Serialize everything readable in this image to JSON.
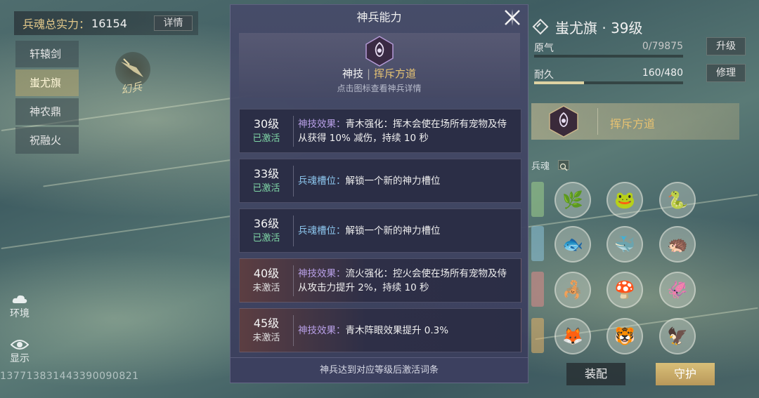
{
  "power": {
    "label": "兵魂总实力：",
    "value": "16154",
    "detail_label": "详情"
  },
  "weapons": [
    {
      "label": "轩辕剑",
      "active": false
    },
    {
      "label": "蚩尤旗",
      "active": true
    },
    {
      "label": "神农鼎",
      "active": false
    },
    {
      "label": "祝融火",
      "active": false
    }
  ],
  "emblem_text": "幻兵",
  "sidebar": {
    "env_label": "环境",
    "display_label": "显示"
  },
  "uid": "13771383144339009082​1",
  "panel": {
    "title": "神兵能力",
    "skill_kind": "神技",
    "skill_sep": "|",
    "skill_name": "挥斥方道",
    "skill_hint": "点击图标查看神兵详情",
    "rows": [
      {
        "level": "30级",
        "state": "已激活",
        "active": true,
        "tag": "神技效果：",
        "tag_type": "skill",
        "text": "青木强化：挥木会使在场所有宠物及侍从获得 10% 减伤，持续 10 秒"
      },
      {
        "level": "33级",
        "state": "已激活",
        "active": true,
        "tag": "兵魂槽位：",
        "tag_type": "slot",
        "text": "解锁一个新的神力槽位"
      },
      {
        "level": "36级",
        "state": "已激活",
        "active": true,
        "tag": "兵魂槽位：",
        "tag_type": "slot",
        "text": "解锁一个新的神力槽位"
      },
      {
        "level": "40级",
        "state": "未激活",
        "active": false,
        "tag": "神技效果：",
        "tag_type": "skill",
        "text": "流火强化：控火会使在场所有宠物及侍从攻击力提升 2%，持续 10 秒"
      },
      {
        "level": "45级",
        "state": "未激活",
        "active": false,
        "tag": "神技效果：",
        "tag_type": "skill",
        "text": "青木阵眼效果提升 0.3%"
      }
    ],
    "footer": "神兵达到对应等级后激活词条"
  },
  "right": {
    "title": "蚩尤旗 · 39级",
    "yuanqi_label": "原气",
    "yuanqi_value": "0/79875",
    "yuanqi_ratio": 0,
    "upgrade_label": "升级",
    "durability_label": "耐久",
    "durability_value": "160/480",
    "durability_ratio": 0.333,
    "repair_label": "修理",
    "skill_name": "挥斥方道",
    "soul_label": "兵魂",
    "equip_label": "装配",
    "guard_label": "守护"
  },
  "soul_rows": [
    {
      "tag_color": "#9fcf8c",
      "icons": [
        "🌿",
        "🐸",
        "🐍"
      ],
      "icon_color": "#3fb36a"
    },
    {
      "tag_color": "#8cc2d8",
      "icons": [
        "🐟",
        "🐳",
        "🦔"
      ],
      "icon_color": "#2fa6c2"
    },
    {
      "tag_color": "#e08a8a",
      "icons": [
        "🦂",
        "🍄",
        "🦑"
      ],
      "icon_color": "#d04a4a"
    },
    {
      "tag_color": "#e5b56a",
      "icons": [
        "🦊",
        "🐯",
        "🦅"
      ],
      "icon_color": "#e07a2a"
    }
  ]
}
